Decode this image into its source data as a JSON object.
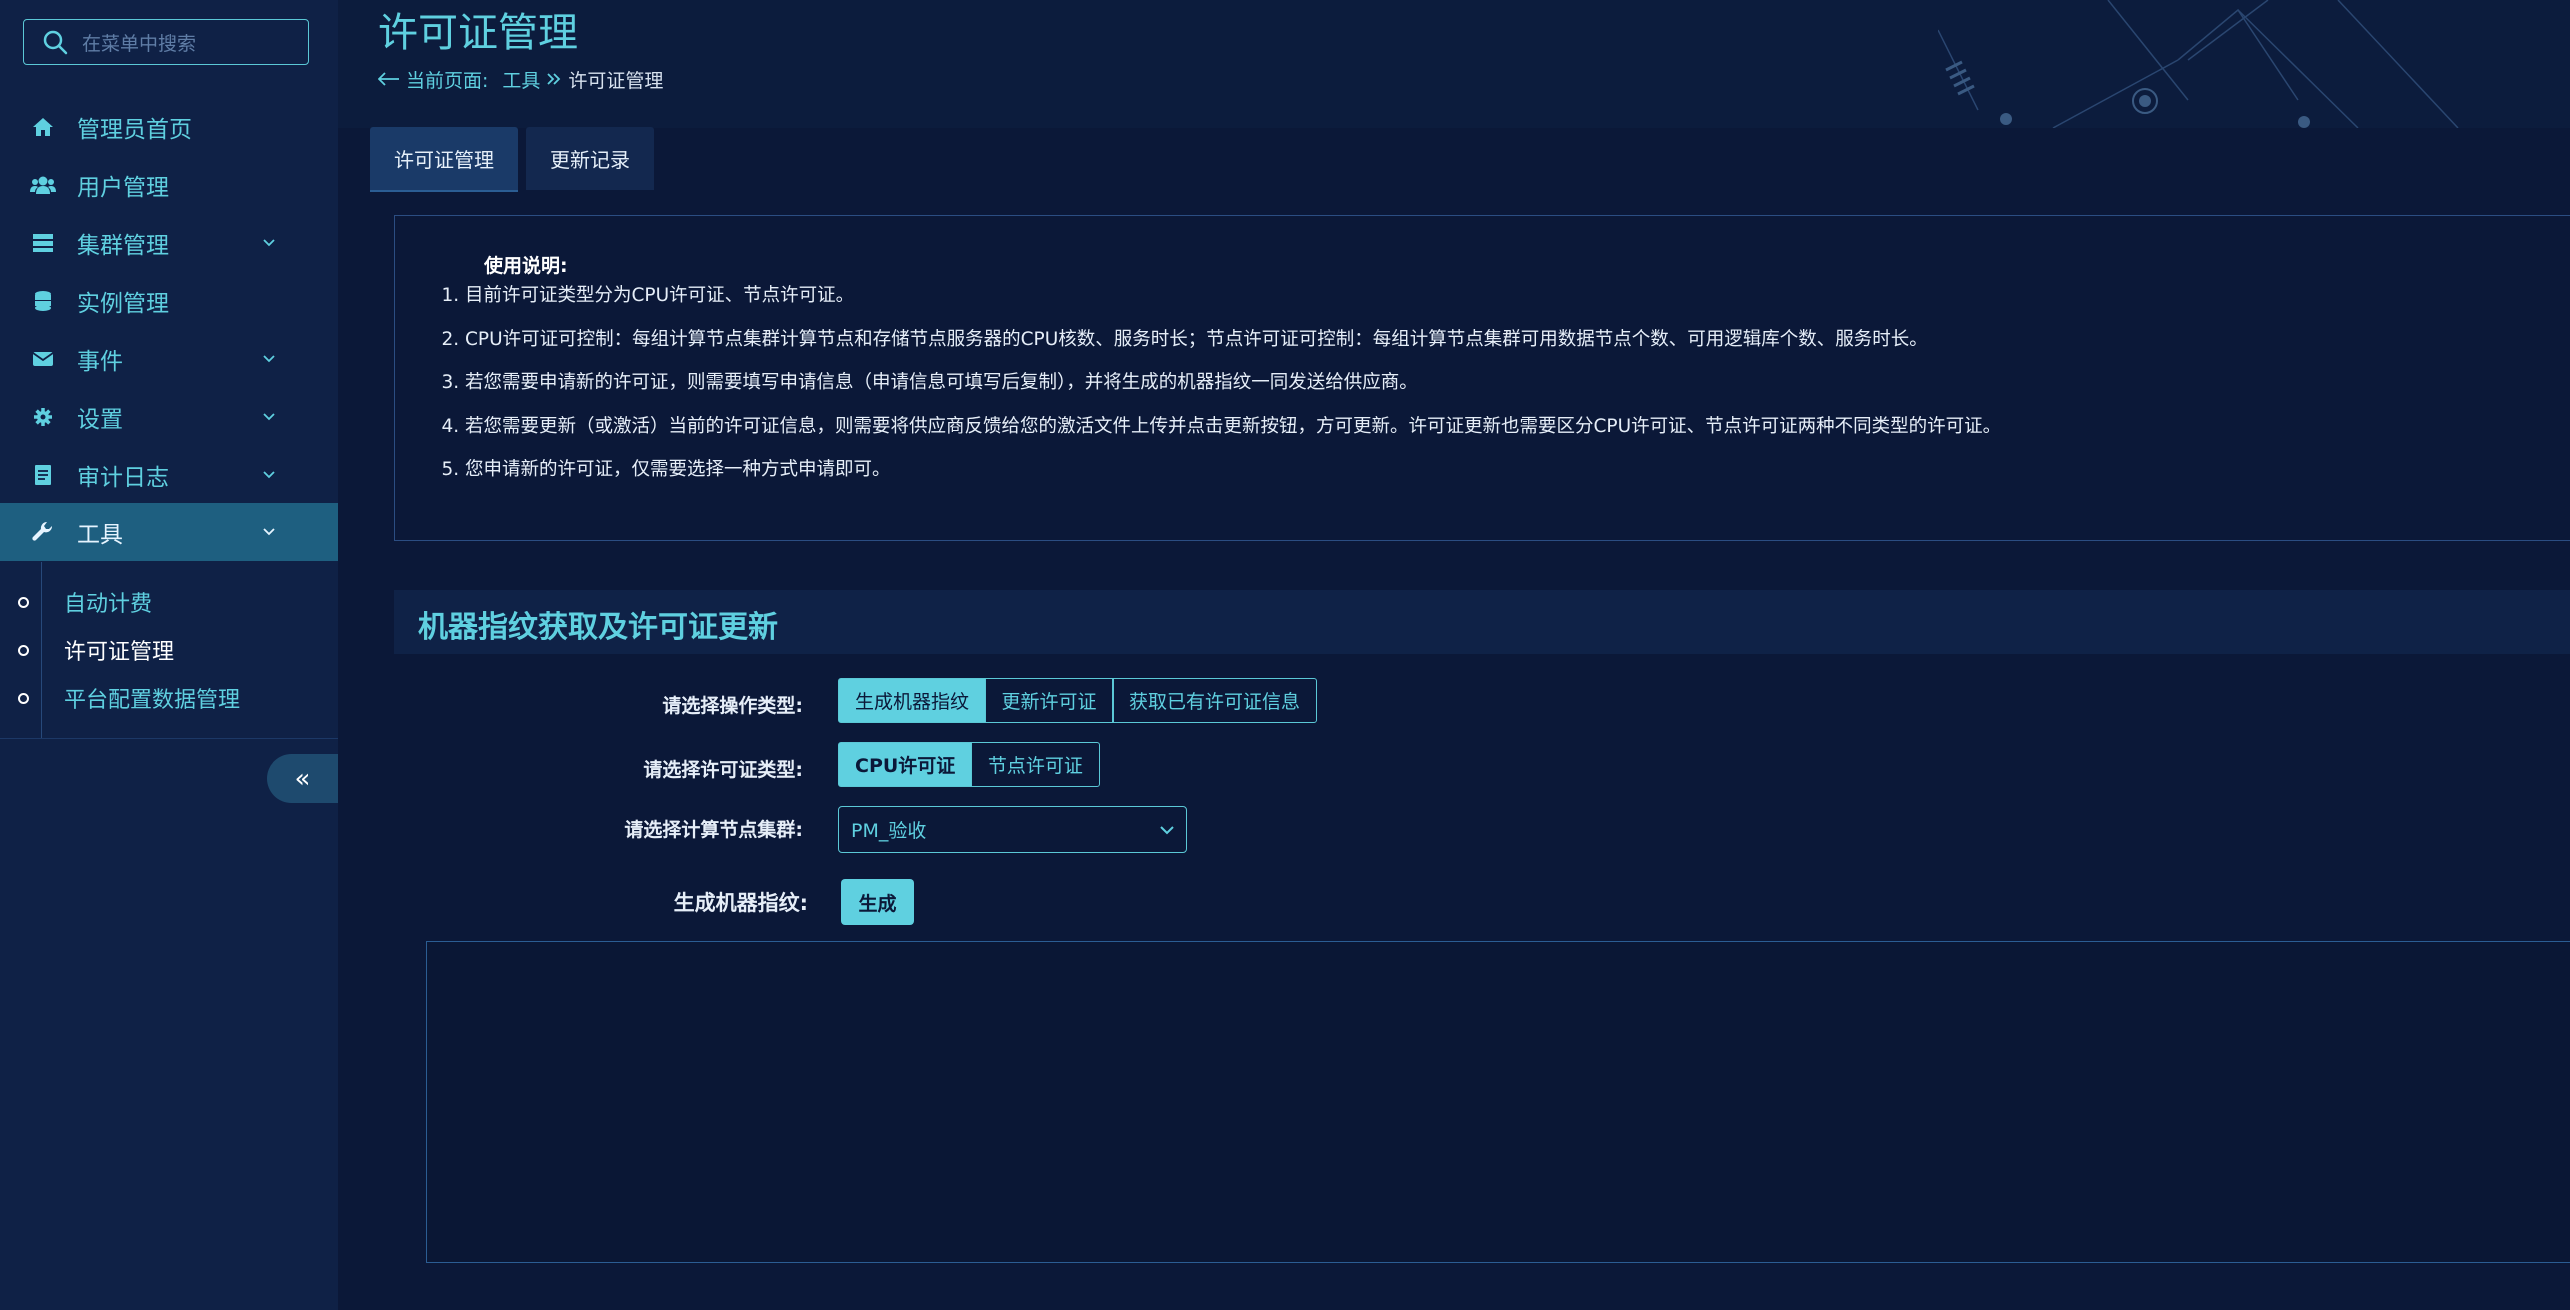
{
  "sidebar": {
    "search_placeholder": "在菜单中搜索",
    "items": [
      {
        "label": "管理员首页",
        "icon": "home-icon"
      },
      {
        "label": "用户管理",
        "icon": "users-icon"
      },
      {
        "label": "集群管理",
        "icon": "server-icon"
      },
      {
        "label": "实例管理",
        "icon": "database-icon"
      },
      {
        "label": "事件",
        "icon": "envelope-icon"
      },
      {
        "label": "设置",
        "icon": "gear-icon"
      },
      {
        "label": "审计日志",
        "icon": "file-icon"
      },
      {
        "label": "工具",
        "icon": "wrench-icon"
      }
    ],
    "submenu": [
      {
        "label": "自动计费",
        "color": "#5fd0e0"
      },
      {
        "label": "许可证管理",
        "color": "#ffffff"
      },
      {
        "label": "平台配置数据管理",
        "color": "#5fd0e0"
      }
    ],
    "collapse_glyph": "«"
  },
  "header": {
    "title": "许可证管理",
    "breadcrumb": {
      "prefix": "当前页面:",
      "parent": "工具",
      "current": "许可证管理"
    }
  },
  "tabs": [
    {
      "label": "许可证管理",
      "active": true
    },
    {
      "label": "更新记录",
      "active": false
    }
  ],
  "instructions": {
    "heading": "使用说明:",
    "items": [
      "目前许可证类型分为CPU许可证、节点许可证。",
      "CPU许可证可控制：每组计算节点集群计算节点和存储节点服务器的CPU核数、服务时长；节点许可证可控制：每组计算节点集群可用数据节点个数、可用逻辑库个数、服务时长。",
      "若您需要申请新的许可证，则需要填写申请信息（申请信息可填写后复制），并将生成的机器指纹一同发送给供应商。",
      "若您需要更新（或激活）当前的许可证信息，则需要将供应商反馈给您的激活文件上传并点击更新按钮，方可更新。许可证更新也需要区分CPU许可证、节点许可证两种不同类型的许可证。",
      "您申请新的许可证，仅需要选择一种方式申请即可。"
    ]
  },
  "section": {
    "title": "机器指纹获取及许可证更新",
    "operation_label": "请选择操作类型:",
    "operation_options": [
      "生成机器指纹",
      "更新许可证",
      "获取已有许可证信息"
    ],
    "license_type_label": "请选择许可证类型:",
    "license_type_options": [
      "CPU许可证",
      "节点许可证"
    ],
    "cluster_label": "请选择计算节点集群:",
    "cluster_value": "PM_验收",
    "fingerprint_label": "生成机器指纹:",
    "generate_button": "生成"
  },
  "colors": {
    "accent": "#5fd0e0",
    "background": "#0b1838",
    "sidebar": "#0f2146",
    "active_nav": "#1e5f80"
  }
}
